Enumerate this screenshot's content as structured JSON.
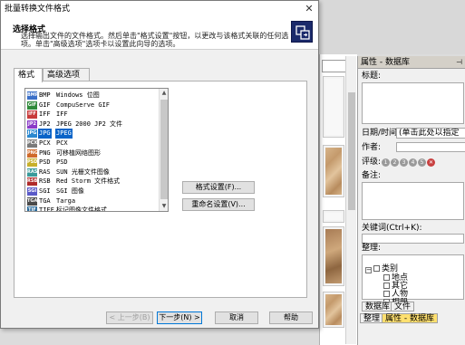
{
  "dialog": {
    "title": "批量转换文件格式",
    "close_glyph": "✕",
    "header_title": "选择格式",
    "header_desc": "选择输出文件的文件格式。然后单击\"格式设置\"按钮，以更改与该格式关联的任何选项。单击\"高级选项\"选项卡以设置此向导的选项。",
    "tabs": [
      "格式",
      "高级选项"
    ],
    "formats": [
      {
        "ext": "BMP",
        "desc": "Windows 位图",
        "icon_color": "#3a6fc8"
      },
      {
        "ext": "GIF",
        "desc": "CompuServe GIF",
        "icon_color": "#2f8a3a"
      },
      {
        "ext": "IFF",
        "desc": "IFF",
        "icon_color": "#c83a3a"
      },
      {
        "ext": "JP2",
        "desc": "JPEG 2000 JP2 文件",
        "icon_color": "#8a3ac8"
      },
      {
        "ext": "JPG",
        "desc": "JPEG",
        "icon_color": "#2a88d0"
      },
      {
        "ext": "PCX",
        "desc": "PCX",
        "icon_color": "#7a7a7a"
      },
      {
        "ext": "PNG",
        "desc": "可移植网络图形",
        "icon_color": "#d06a2a"
      },
      {
        "ext": "PSD",
        "desc": "PSD",
        "icon_color": "#c8b02a"
      },
      {
        "ext": "RAS",
        "desc": "SUN 光栅文件图像",
        "icon_color": "#3a9a9a"
      },
      {
        "ext": "RSB",
        "desc": "Red Storm 文件格式",
        "icon_color": "#b02a2a"
      },
      {
        "ext": "SGI",
        "desc": "SGI 图像",
        "icon_color": "#5a5ac8"
      },
      {
        "ext": "TGA",
        "desc": "Targa",
        "icon_color": "#4a4a4a"
      },
      {
        "ext": "TIFF",
        "desc": "标记图像文件格式",
        "icon_color": "#2a6a9a"
      }
    ],
    "selected_index": 4,
    "format_settings_button": "格式设置(F)...",
    "rename_settings_button": "重命名设置(V)...",
    "buttons": {
      "back": "< 上一步(B)",
      "next": "下一步(N) >",
      "cancel": "取消",
      "help": "帮助"
    }
  },
  "background": {
    "props_title": "属性 - 数据库",
    "pin_glyph": "📌",
    "title_label": "标题:",
    "date_label": "日期/时间:",
    "date_value": "(单击此处以指定",
    "author_label": "作者:",
    "rating_label": "评级:",
    "rating_values": [
      "1",
      "2",
      "3",
      "4",
      "5",
      "✕"
    ],
    "notes_label": "备注:",
    "keywords_label": "关键词(Ctrl+K):",
    "organize_label": "整理:",
    "tree_root": "类别",
    "tree_items": [
      "地点",
      "其它",
      "人物",
      "相册"
    ],
    "tabs_upper": [
      "数据库",
      "文件"
    ],
    "tabs_lower": [
      "整理",
      "属性 - 数据库"
    ],
    "combo_arrow": "▼"
  }
}
